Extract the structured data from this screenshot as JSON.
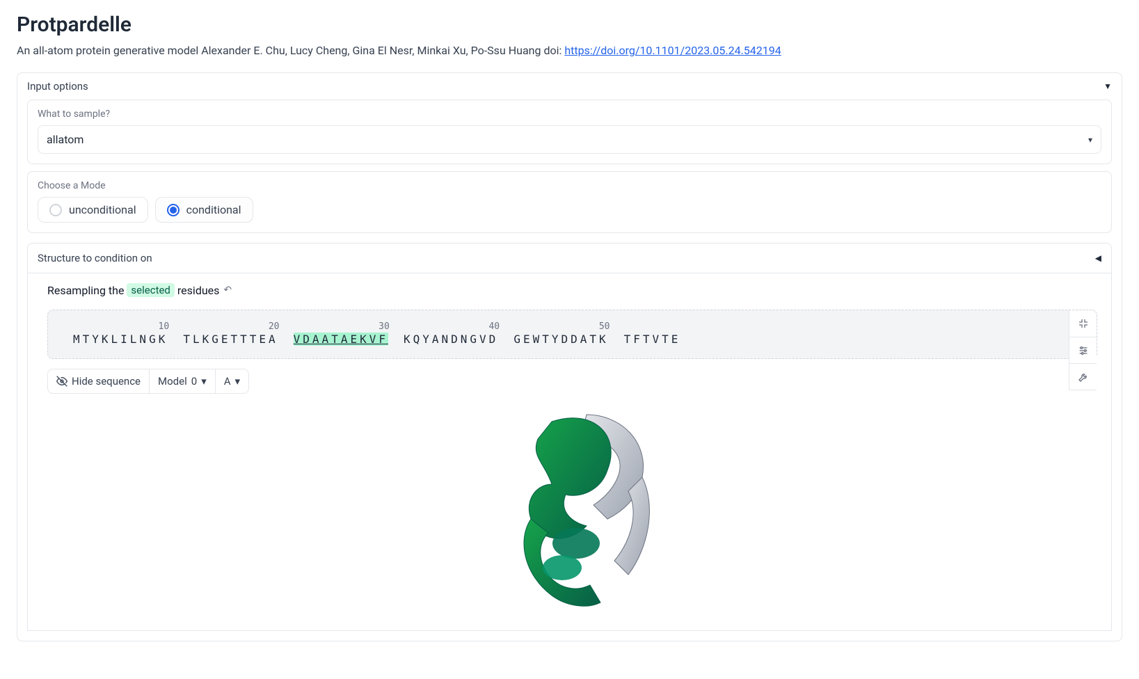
{
  "title": "Protpardelle",
  "lead_text": "An all-atom protein generative model Alexander E. Chu, Lucy Cheng, Gina El Nesr, Minkai Xu, Po-Ssu Huang doi: ",
  "doi_url_text": "https://doi.org/10.1101/2023.05.24.542194",
  "panels": {
    "input_options": "Input options",
    "what_to_sample": "What to sample?",
    "sample_value": "allatom",
    "choose_mode": "Choose a Mode",
    "modes": {
      "unconditional": "unconditional",
      "conditional": "conditional"
    },
    "mode_selected": "conditional",
    "structure_header": "Structure to condition on"
  },
  "resample": {
    "prefix": "Resampling the ",
    "selected": "selected",
    "suffix": " residues"
  },
  "sequence": {
    "ticks": [
      10,
      20,
      30,
      40,
      50
    ],
    "groups": [
      {
        "text": "MTYKLILNGK",
        "hl": false
      },
      {
        "text": "TLKGETTTEA",
        "hl": false
      },
      {
        "text": "VDAATAEKVF",
        "hl": true
      },
      {
        "text": "KQYANDNGVD",
        "hl": false
      },
      {
        "text": "GEWTYDDATK",
        "hl": false
      },
      {
        "text": "TFTVTE",
        "hl": false
      }
    ]
  },
  "controls": {
    "hide_sequence": "Hide sequence",
    "model_label": "Model",
    "model_value": "0",
    "chain_value": "A"
  }
}
